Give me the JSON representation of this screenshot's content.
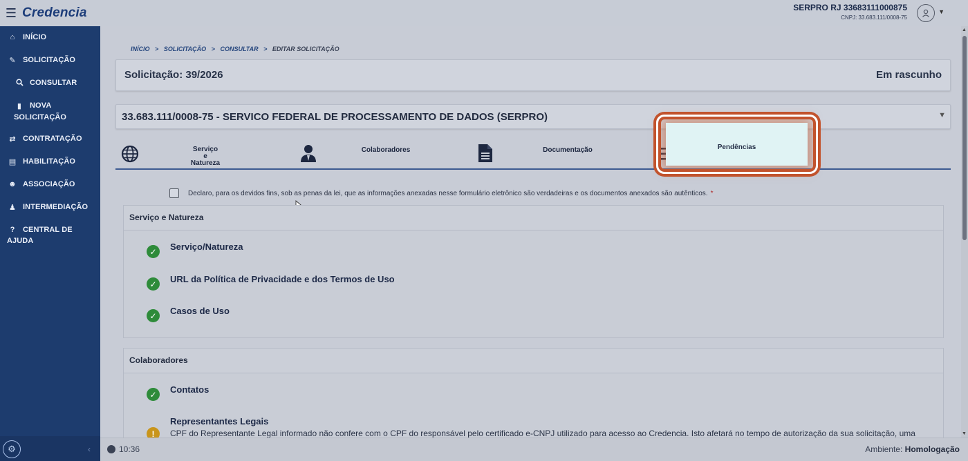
{
  "header": {
    "app_name": "Credencia",
    "user_name": "SERPRO RJ 33683111000875",
    "user_cnpj": "CNPJ: 33.683.111/0008-75"
  },
  "sidebar": {
    "items": [
      {
        "label": "INÍCIO",
        "icon": "home-icon"
      },
      {
        "label": "SOLICITAÇÃO",
        "icon": "edit-icon"
      },
      {
        "label": "CONSULTAR",
        "icon": "search-icon"
      },
      {
        "label": "NOVA",
        "label2": "SOLICITAÇÃO",
        "icon": "file-icon"
      },
      {
        "label": "CONTRATAÇÃO",
        "icon": "handshake-icon"
      },
      {
        "label": "HABILITAÇÃO",
        "icon": "id-card-icon"
      },
      {
        "label": "ASSOCIAÇÃO",
        "icon": "users-icon"
      },
      {
        "label": "INTERMEDIAÇÃO",
        "icon": "user-tie-icon"
      },
      {
        "label": "CENTRAL DE",
        "label2": "AJUDA",
        "icon": "question-icon"
      }
    ],
    "collapse_glyph": "‹"
  },
  "breadcrumb": {
    "items": [
      "INÍCIO",
      "SOLICITAÇÃO",
      "CONSULTAR",
      "EDITAR SOLICITAÇÃO"
    ],
    "separator": ">"
  },
  "solicitacao": {
    "title": "Solicitação: 39/2026",
    "status": "Em rascunho"
  },
  "organization": {
    "title": "33.683.111/0008-75 - SERVICO FEDERAL DE PROCESSAMENTO DE DADOS (SERPRO)"
  },
  "tabs": [
    {
      "label_line1": "Serviço",
      "label_line2": "e",
      "label_line3": "Natureza",
      "icon": "globe-icon"
    },
    {
      "label": "Colaboradores",
      "icon": "user-icon"
    },
    {
      "label": "Documentação",
      "icon": "document-icon"
    },
    {
      "label": "Pendências",
      "icon": "list-icon"
    }
  ],
  "declaration": {
    "text": "Declaro, para os devidos fins, sob as penas da lei, que as informações anexadas nesse formulário eletrônico são verdadeiras e os documentos anexados são autênticos.",
    "required_mark": "*"
  },
  "sections": [
    {
      "title": "Serviço e Natureza",
      "items": [
        "Serviço/Natureza",
        "URL da Política de Privacidade e dos Termos de Uso",
        "Casos de Uso"
      ]
    },
    {
      "title": "Colaboradores",
      "items": [
        "Contatos",
        "Representantes Legais"
      ],
      "warning_text": "CPF do Representante Legal informado não confere com o CPF do responsável pelo certificado e-CNPJ utilizado para acesso ao Credencia. Isto afetará no tempo de autorização da sua solicitação, uma"
    }
  ],
  "footer": {
    "time": "10:36",
    "env_label": "Ambiente:",
    "env_value": "Homologação"
  },
  "colors": {
    "sidebar": "#1d3c6e",
    "accent": "#3d5a91",
    "check": "#2e8b3a",
    "warning": "#c9951b",
    "highlight": "#c2532d"
  }
}
